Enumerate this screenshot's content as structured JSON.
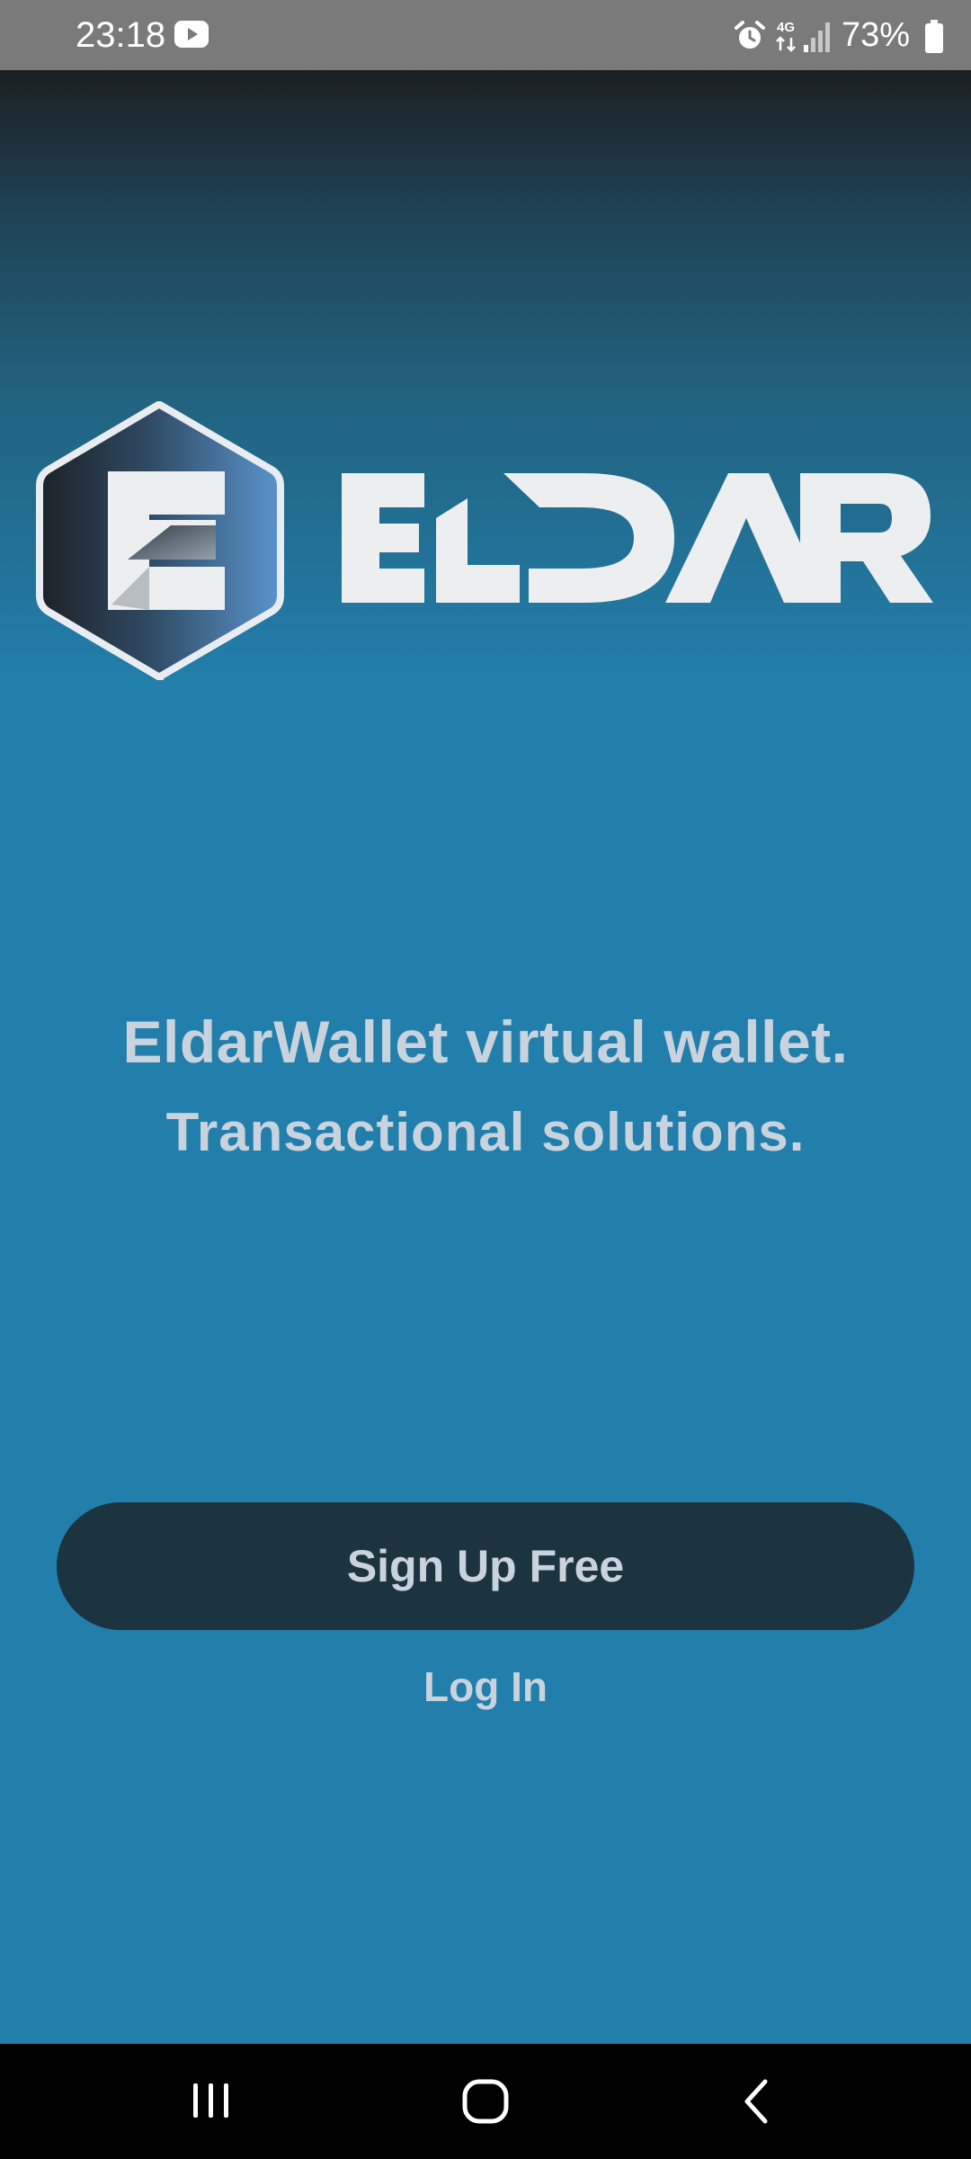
{
  "status_bar": {
    "time": "23:18",
    "battery": "73%",
    "network_label": "4G",
    "icons": [
      "youtube-icon",
      "alarm-icon",
      "network-4g-icon",
      "signal-icon",
      "battery-icon"
    ]
  },
  "logo": {
    "wordmark": "ELDAR",
    "badge_letter": "E"
  },
  "hero": {
    "tagline": "EldarWallet virtual wallet.",
    "subtagline": "Transactional solutions."
  },
  "actions": {
    "signup_label": "Sign Up Free",
    "login_label": "Log In"
  },
  "nav_bar": {
    "icons": [
      "recents-icon",
      "home-icon",
      "back-icon"
    ]
  },
  "colors": {
    "background": "#227eab",
    "background_top": "#1b1f22",
    "text": "#c9d3de",
    "button": "#1c3440",
    "status_bar": "#7a7a7a",
    "nav_bar": "#000000"
  }
}
